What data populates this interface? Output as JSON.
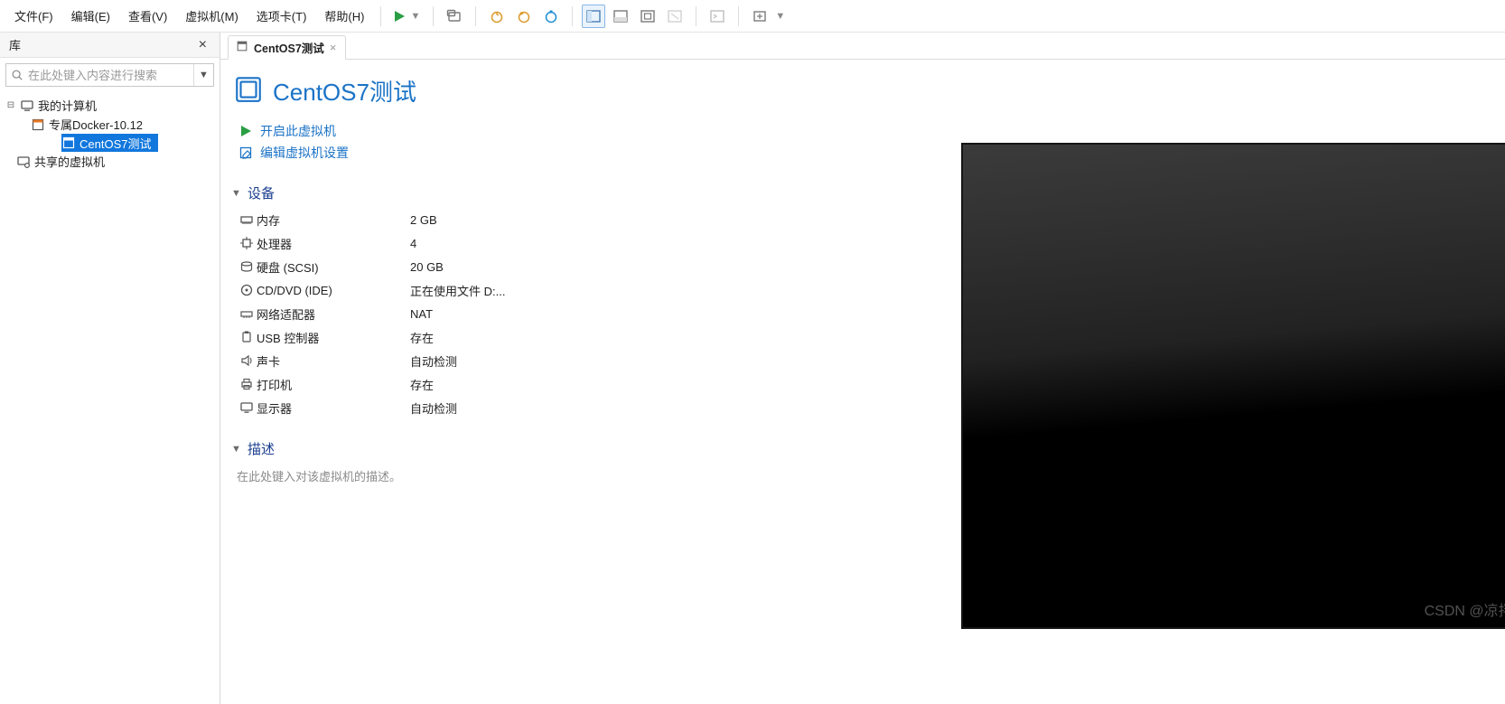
{
  "menu": {
    "items": [
      "文件(F)",
      "编辑(E)",
      "查看(V)",
      "虚拟机(M)",
      "选项卡(T)",
      "帮助(H)"
    ]
  },
  "sidebar": {
    "title": "库",
    "search_placeholder": "在此处键入内容进行搜索",
    "tree": {
      "root": "我的计算机",
      "children": [
        "专属Docker-10.12",
        "CentOS7测试"
      ],
      "shared": "共享的虚拟机"
    }
  },
  "tab": {
    "label": "CentOS7测试"
  },
  "main": {
    "title": "CentOS7测试",
    "actions": {
      "power_on": "开启此虚拟机",
      "edit_settings": "编辑虚拟机设置"
    },
    "sections": {
      "devices": "设备",
      "description": "描述"
    },
    "devices": [
      {
        "icon": "memory",
        "label": "内存",
        "value": "2 GB"
      },
      {
        "icon": "cpu",
        "label": "处理器",
        "value": "4"
      },
      {
        "icon": "disk",
        "label": "硬盘 (SCSI)",
        "value": "20 GB"
      },
      {
        "icon": "cd",
        "label": "CD/DVD (IDE)",
        "value": "正在使用文件 D:..."
      },
      {
        "icon": "net",
        "label": "网络适配器",
        "value": "NAT"
      },
      {
        "icon": "usb",
        "label": "USB 控制器",
        "value": "存在"
      },
      {
        "icon": "sound",
        "label": "声卡",
        "value": "自动检测"
      },
      {
        "icon": "printer",
        "label": "打印机",
        "value": "存在"
      },
      {
        "icon": "display",
        "label": "显示器",
        "value": "自动检测"
      }
    ],
    "description_placeholder": "在此处键入对该虚拟机的描述。"
  },
  "watermark": "CSDN @凉拌~玛卡巴卡"
}
